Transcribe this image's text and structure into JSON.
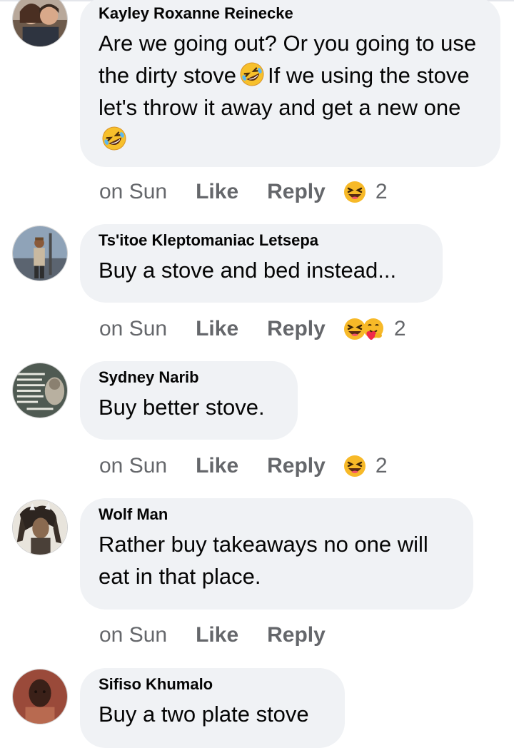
{
  "comments": [
    {
      "author": "Kayley Roxanne Reinecke",
      "text_parts": [
        "Are we going out? Or you going to use the dirty stove",
        "If we using the stove let's throw it away and get a new one"
      ],
      "time": "on Sun",
      "like": "Like",
      "reply": "Reply",
      "reaction_icons": [
        "haha-icon"
      ],
      "reaction_count": "2"
    },
    {
      "author": "Ts'itoe Kleptomaniac Letsepa",
      "text": "Buy a stove and bed  instead...",
      "time": "on Sun",
      "like": "Like",
      "reply": "Reply",
      "reaction_icons": [
        "haha-icon",
        "care-icon"
      ],
      "reaction_count": "2"
    },
    {
      "author": "Sydney Narib",
      "text": "Buy better stove.",
      "time": "on Sun",
      "like": "Like",
      "reply": "Reply",
      "reaction_icons": [
        "haha-icon"
      ],
      "reaction_count": "2"
    },
    {
      "author": "Wolf Man",
      "text": "Rather buy takeaways no one will eat in that place.",
      "time": "on Sun",
      "like": "Like",
      "reply": "Reply"
    },
    {
      "author": "Sifiso Khumalo",
      "text": "Buy a two plate stove"
    }
  ],
  "colors": {
    "bubble": "#f0f2f5",
    "meta_text": "#65676b",
    "haha_yellow": "#f7b928"
  }
}
